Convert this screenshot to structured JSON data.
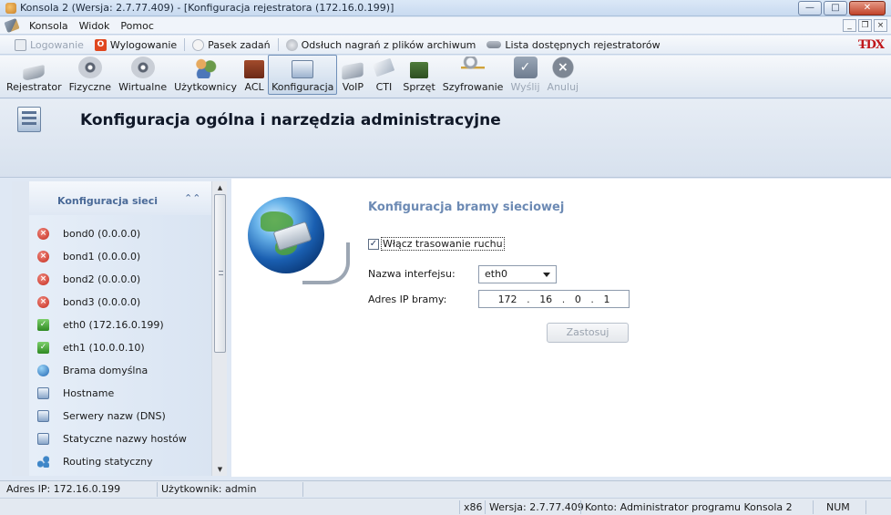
{
  "window": {
    "title": "Konsola 2 (Wersja:  2.7.77.409) - [Konfiguracja rejestratora (172.16.0.199)]"
  },
  "menu": {
    "items": [
      "Konsola",
      "Widok",
      "Pomoc"
    ]
  },
  "quickbar": {
    "login": "Logowanie",
    "logout": "Wylogowanie",
    "taskbar": "Pasek zadań",
    "listen": "Odsłuch nagrań z plików archiwum",
    "recorders": "Lista dostępnych rejestratorów",
    "brand": "T̶DX"
  },
  "toolbar": {
    "items": [
      {
        "label": "Rejestrator",
        "icon": "recorder-icon"
      },
      {
        "label": "Fizyczne",
        "icon": "physical-channels-icon"
      },
      {
        "label": "Wirtualne",
        "icon": "virtual-channels-icon"
      },
      {
        "label": "Użytkownicy",
        "icon": "users-icon"
      },
      {
        "label": "ACL",
        "icon": "acl-icon"
      },
      {
        "label": "Konfiguracja",
        "icon": "configuration-icon",
        "active": true
      },
      {
        "label": "VoIP",
        "icon": "voip-icon"
      },
      {
        "label": "CTI",
        "icon": "cti-icon"
      },
      {
        "label": "Sprzęt",
        "icon": "hardware-icon"
      },
      {
        "label": "Szyfrowanie",
        "icon": "encryption-icon"
      },
      {
        "label": "Wyślij",
        "icon": "send-icon",
        "disabled": true
      },
      {
        "label": "Anuluj",
        "icon": "cancel-icon",
        "disabled": true
      }
    ]
  },
  "header": {
    "title": "Konfiguracja ogólna i narzędzia administracyjne"
  },
  "nav": {
    "group_title": "Konfiguracja sieci",
    "items": [
      {
        "label": "bond0 (0.0.0.0)",
        "status": "error"
      },
      {
        "label": "bond1 (0.0.0.0)",
        "status": "error"
      },
      {
        "label": "bond2 (0.0.0.0)",
        "status": "error"
      },
      {
        "label": "bond3 (0.0.0.0)",
        "status": "error"
      },
      {
        "label": "eth0 (172.16.0.199)",
        "status": "ok"
      },
      {
        "label": "eth1 (10.0.0.10)",
        "status": "ok"
      },
      {
        "label": "Brama domyślna",
        "status": "globe"
      },
      {
        "label": "Hostname",
        "status": "config"
      },
      {
        "label": "Serwery nazw (DNS)",
        "status": "config"
      },
      {
        "label": "Statyczne nazwy hostów",
        "status": "config"
      },
      {
        "label": "Routing statyczny",
        "status": "route"
      }
    ]
  },
  "gateway": {
    "section_title": "Konfiguracja bramy sieciowej",
    "routing_checkbox_label": "Włącz trasowanie ruchu",
    "routing_checked": true,
    "interface_label": "Nazwa interfejsu:",
    "interface_value": "eth0",
    "ip_label": "Adres IP bramy:",
    "ip_octets": [
      "172",
      "16",
      "0",
      "1"
    ],
    "apply_label": "Zastosuj"
  },
  "status": {
    "ip": "Adres IP: 172.16.0.199",
    "user": "Użytkownik: admin",
    "arch": "x86",
    "version": "Wersja: 2.7.77.409",
    "account": "Konto: Administrator programu Konsola 2",
    "num": "NUM"
  },
  "colors": {
    "accent_title": "#6c8ab4",
    "error": "#c42a1c",
    "ok": "#2f8a23",
    "logout": "#e0471f",
    "brand": "#c0161a"
  }
}
